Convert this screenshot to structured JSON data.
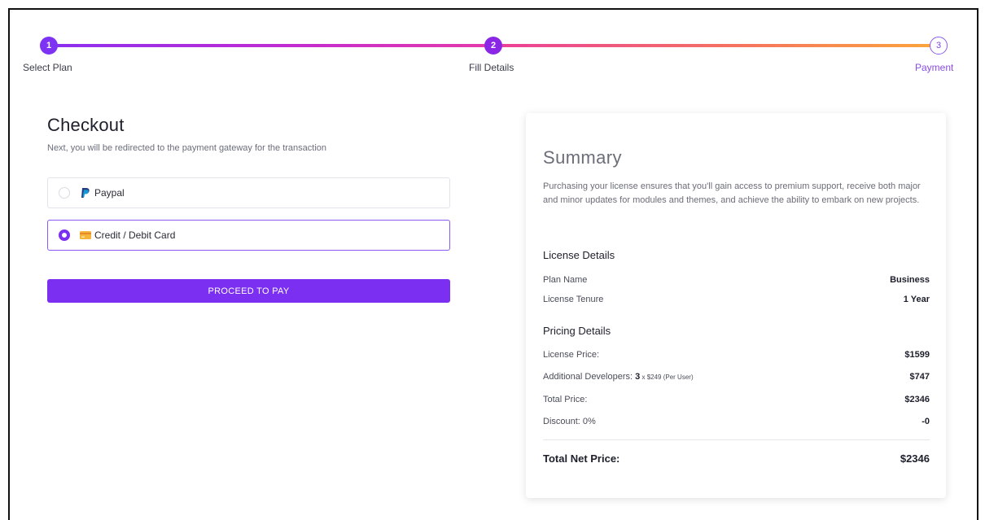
{
  "stepper": {
    "steps": [
      {
        "number": "1",
        "label": "Select Plan"
      },
      {
        "number": "2",
        "label": "Fill Details"
      },
      {
        "number": "3",
        "label": "Payment"
      }
    ]
  },
  "checkout": {
    "title": "Checkout",
    "subtitle": "Next, you will be redirected to the payment gateway for the transaction",
    "options": [
      {
        "label": "Paypal",
        "icon": "paypal-icon",
        "selected": false
      },
      {
        "label": "Credit / Debit Card",
        "icon": "credit-card-icon",
        "selected": true
      }
    ],
    "proceed_label": "PROCEED TO PAY"
  },
  "summary": {
    "title": "Summary",
    "description": "Purchasing your license ensures that you'll gain access to premium support, receive both major and minor updates for modules and themes, and achieve the ability to embark on new projects.",
    "license_heading": "License Details",
    "license_rows": [
      {
        "label": "Plan Name",
        "value": "Business"
      },
      {
        "label": "License Tenure",
        "value": "1 Year"
      }
    ],
    "pricing_heading": "Pricing Details",
    "pricing": {
      "license_price_label": "License Price:",
      "license_price_value": "$1599",
      "additional_label": "Additional Developers: ",
      "additional_count": "3",
      "additional_rate": " x $249 (Per User)",
      "additional_value": "$747",
      "total_label": "Total Price:",
      "total_value": "$2346",
      "discount_label": "Discount: 0%",
      "discount_value": "-0"
    },
    "net_label": "Total Net Price:",
    "net_value": "$2346"
  },
  "colors": {
    "accent": "#7b2ff0",
    "gradient_mid": "#e63aa9",
    "gradient_end": "#fba63a"
  }
}
